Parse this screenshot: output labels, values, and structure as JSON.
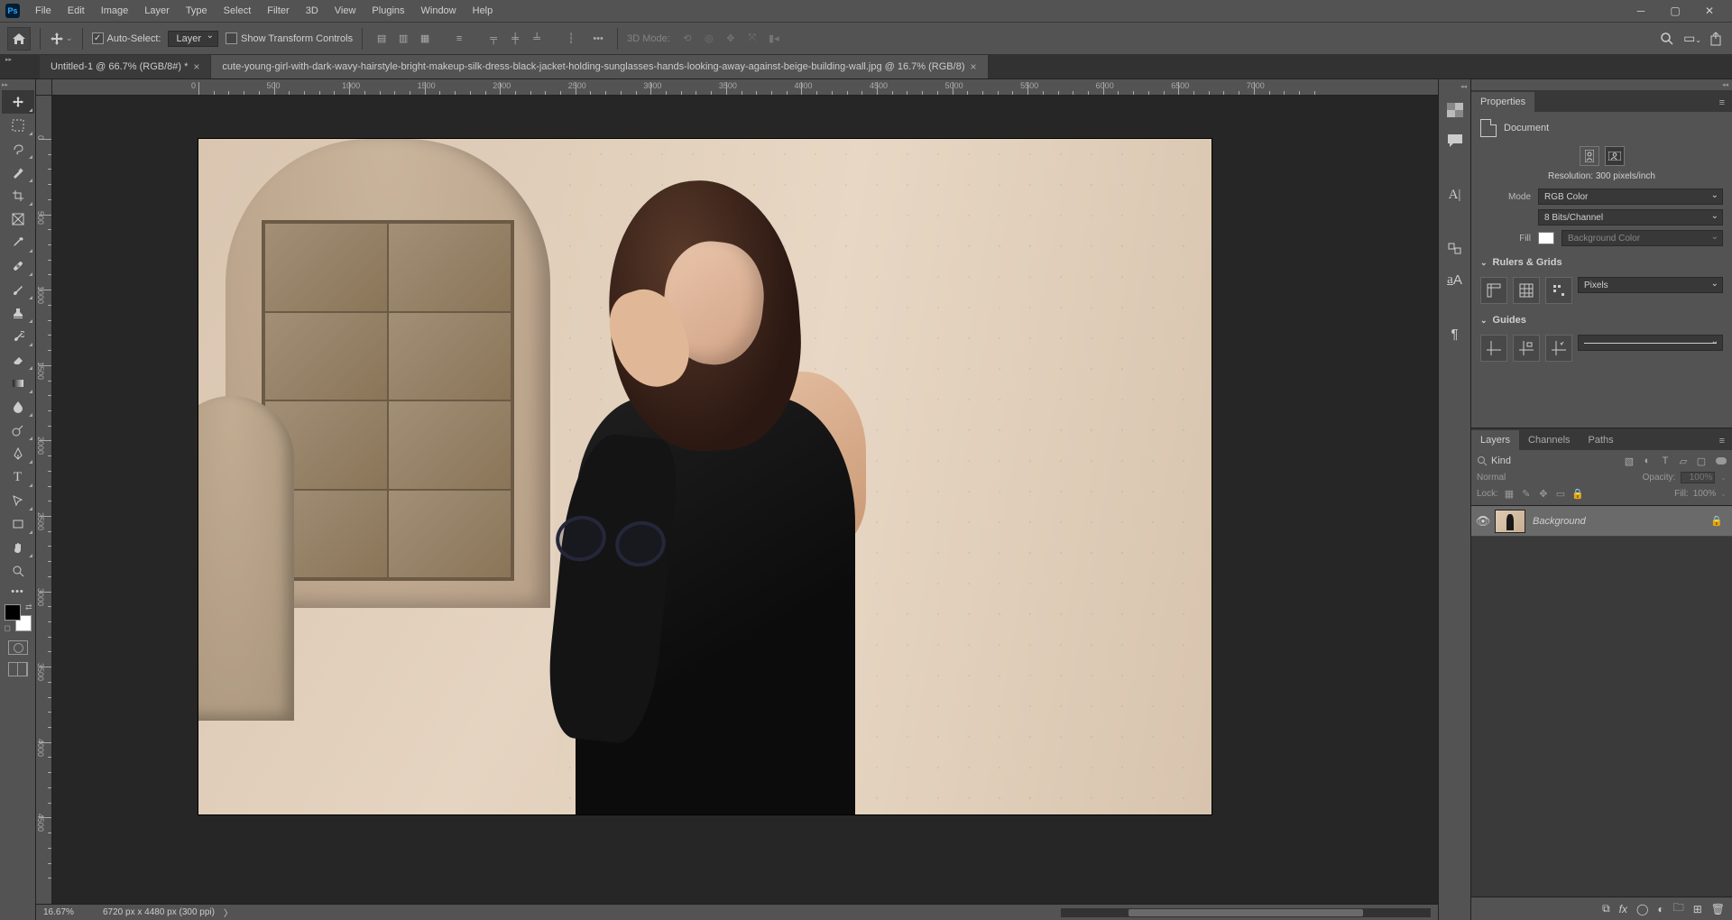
{
  "menu": {
    "file": "File",
    "edit": "Edit",
    "image": "Image",
    "layer": "Layer",
    "type": "Type",
    "select": "Select",
    "filter": "Filter",
    "threeD": "3D",
    "view": "View",
    "plugins": "Plugins",
    "window": "Window",
    "help": "Help"
  },
  "options": {
    "autoSelect": "Auto-Select:",
    "target": "Layer",
    "showTransform": "Show Transform Controls",
    "threeDMode": "3D Mode:"
  },
  "tabs": [
    {
      "title": "Untitled-1 @ 66.7% (RGB/8#) *"
    },
    {
      "title": "cute-young-girl-with-dark-wavy-hairstyle-bright-makeup-silk-dress-black-jacket-holding-sunglasses-hands-looking-away-against-beige-building-wall.jpg @ 16.7% (RGB/8)"
    }
  ],
  "ruler_h": [
    "0",
    "500",
    "1000",
    "1500",
    "2000",
    "2500",
    "3000",
    "3500",
    "4000",
    "4500",
    "5000",
    "5500",
    "6000",
    "6500",
    "7000"
  ],
  "ruler_v": [
    "0",
    "500",
    "1000",
    "1500",
    "2000",
    "2500",
    "3000",
    "3500",
    "4000",
    "4500"
  ],
  "status": {
    "zoom": "16.67%",
    "dims": "6720 px x 4480 px (300 ppi)"
  },
  "properties": {
    "title": "Properties",
    "docLabel": "Document",
    "resolution": "Resolution: 300 pixels/inch",
    "modeLabel": "Mode",
    "mode": "RGB Color",
    "depth": "8 Bits/Channel",
    "fillLabel": "Fill",
    "fillName": "Background Color",
    "rulersGrids": "Rulers & Grids",
    "units": "Pixels",
    "guides": "Guides"
  },
  "layers": {
    "tabs": {
      "layers": "Layers",
      "channels": "Channels",
      "paths": "Paths"
    },
    "kindPlaceholder": "Kind",
    "blend": "Normal",
    "opacityLabel": "Opacity:",
    "opacity": "100%",
    "lockLabel": "Lock:",
    "fillLabel": "Fill:",
    "fill": "100%",
    "layer0": "Background"
  }
}
